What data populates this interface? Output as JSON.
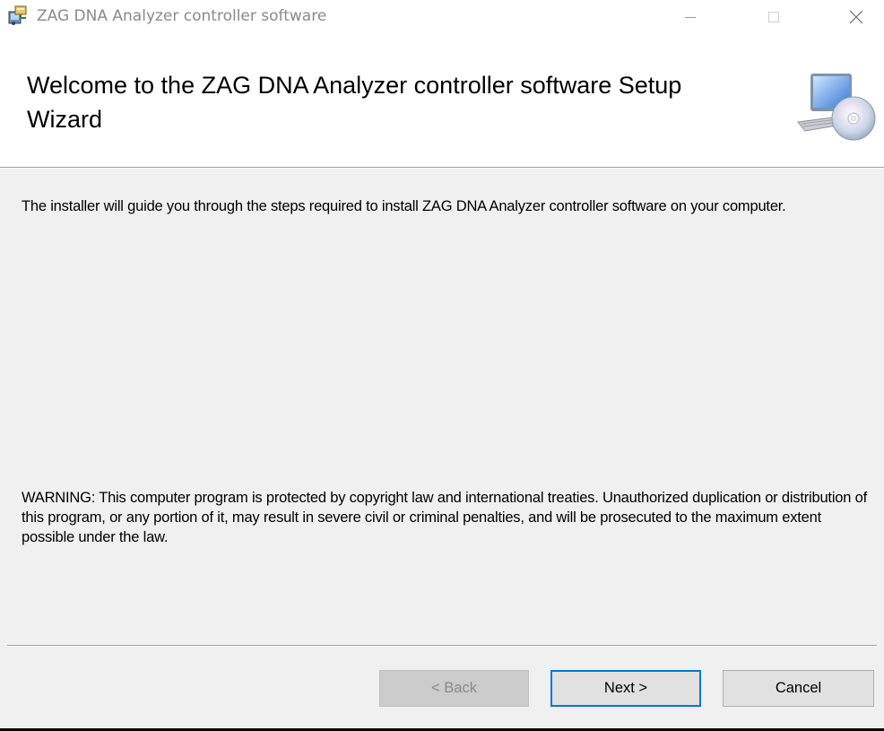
{
  "window": {
    "title": "ZAG DNA Analyzer controller software",
    "icons": {
      "app": "installer-icon",
      "minimize": "minimize-icon",
      "maximize": "maximize-icon",
      "close": "close-icon",
      "header": "computer-cd-icon"
    }
  },
  "header": {
    "title": "Welcome to the ZAG DNA Analyzer controller software Setup Wizard"
  },
  "body": {
    "intro": "The installer will guide you through the steps required to install ZAG DNA Analyzer controller software on your computer.",
    "warning": "WARNING: This computer program is protected by copyright law and international treaties. Unauthorized duplication or distribution of this program, or any portion of it, may result in severe civil or criminal penalties, and will be prosecuted to the maximum extent possible under the law."
  },
  "buttons": {
    "back": "< Back",
    "next": "Next >",
    "cancel": "Cancel"
  },
  "colors": {
    "accent": "#0078d7",
    "background": "#f0f0f0",
    "header_background": "#ffffff",
    "disabled_text": "#8a8a8a"
  }
}
